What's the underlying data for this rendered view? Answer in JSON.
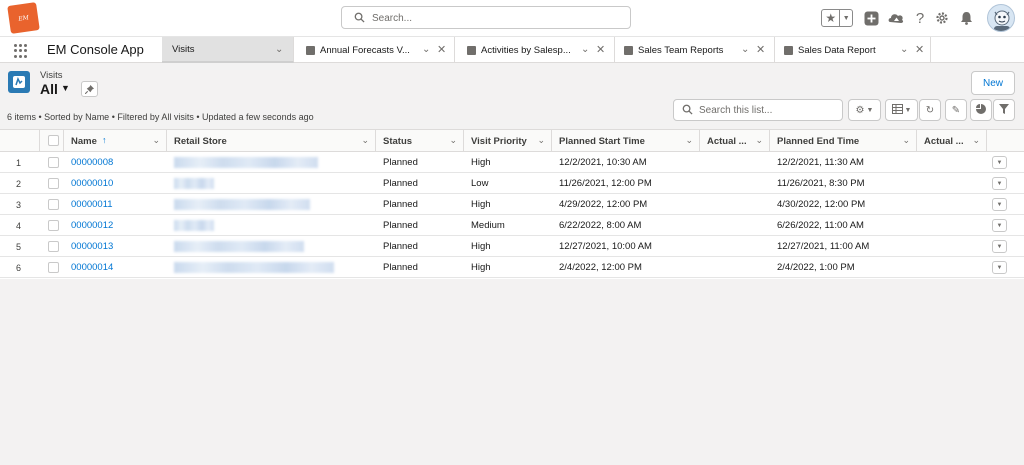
{
  "header": {
    "logo_text": "EM",
    "search_placeholder": "Search..."
  },
  "nav": {
    "app_name": "EM Console App",
    "tabs": [
      {
        "label": "Visits",
        "active": true,
        "icon": "none"
      },
      {
        "label": "Annual Forecasts V...",
        "icon": "forecast-icon"
      },
      {
        "label": "Activities by Salesp...",
        "icon": "report-icon"
      },
      {
        "label": "Sales Team Reports",
        "icon": "folder-icon"
      },
      {
        "label": "Sales Data Report",
        "icon": "report-icon"
      }
    ]
  },
  "list": {
    "object_label": "Visits",
    "view_name": "All",
    "new_button": "New",
    "info": "6 items • Sorted by Name • Filtered by All visits • Updated a few seconds ago",
    "search_placeholder": "Search this list..."
  },
  "table": {
    "columns": [
      "Name",
      "Retail Store",
      "Status",
      "Visit Priority",
      "Planned Start Time",
      "Actual ...",
      "Planned End Time",
      "Actual ..."
    ],
    "rows": [
      {
        "num": "1",
        "name": "00000008",
        "status": "Planned",
        "priority": "High",
        "planned_start": "12/2/2021, 10:30 AM",
        "actual_start": "",
        "planned_end": "12/2/2021, 11:30 AM",
        "actual_end": ""
      },
      {
        "num": "2",
        "name": "00000010",
        "status": "Planned",
        "priority": "Low",
        "planned_start": "11/26/2021, 12:00 PM",
        "actual_start": "",
        "planned_end": "11/26/2021, 8:30 PM",
        "actual_end": ""
      },
      {
        "num": "3",
        "name": "00000011",
        "status": "Planned",
        "priority": "High",
        "planned_start": "4/29/2022, 12:00 PM",
        "actual_start": "",
        "planned_end": "4/30/2022, 12:00 PM",
        "actual_end": ""
      },
      {
        "num": "4",
        "name": "00000012",
        "status": "Planned",
        "priority": "Medium",
        "planned_start": "6/22/2022, 8:00 AM",
        "actual_start": "",
        "planned_end": "6/26/2022, 11:00 AM",
        "actual_end": ""
      },
      {
        "num": "5",
        "name": "00000013",
        "status": "Planned",
        "priority": "High",
        "planned_start": "12/27/2021, 10:00 AM",
        "actual_start": "",
        "planned_end": "12/27/2021, 11:00 AM",
        "actual_end": ""
      },
      {
        "num": "6",
        "name": "00000014",
        "status": "Planned",
        "priority": "High",
        "planned_start": "2/4/2022, 12:00 PM",
        "actual_start": "",
        "planned_end": "2/4/2022, 1:00 PM",
        "actual_end": ""
      }
    ]
  },
  "colors": {
    "accent": "#0176d3",
    "object_icon": "#2a7ab4",
    "logo": "#e9632d"
  }
}
